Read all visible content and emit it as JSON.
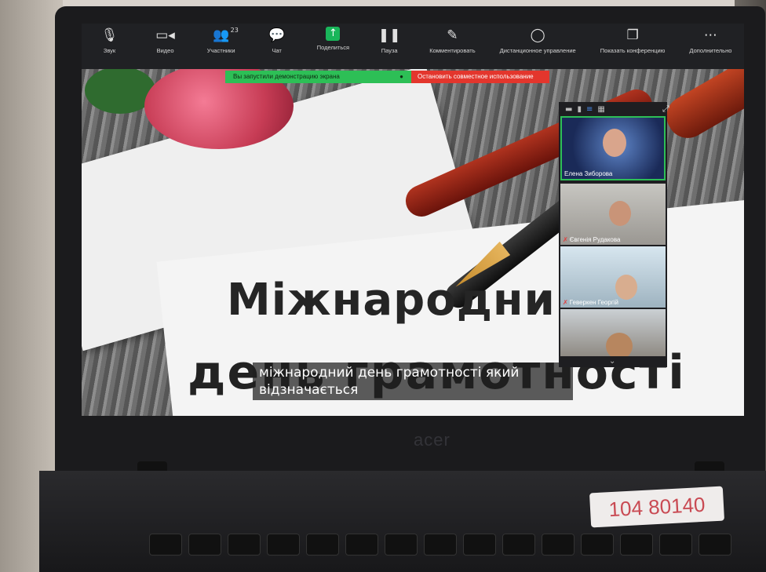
{
  "toolbar": {
    "items": [
      {
        "label": "Звук",
        "icon": "microphone-icon"
      },
      {
        "label": "Видео",
        "icon": "video-camera-icon"
      },
      {
        "label": "Участники",
        "icon": "participants-icon",
        "count": "23"
      },
      {
        "label": "Чат",
        "icon": "chat-icon"
      },
      {
        "label": "Поделиться",
        "icon": "share-screen-icon"
      },
      {
        "label": "Пауза",
        "icon": "pause-icon"
      },
      {
        "label": "Комментировать",
        "icon": "annotate-icon"
      },
      {
        "label": "Дистанционное управление",
        "icon": "remote-control-icon"
      },
      {
        "label": "Показать конференцию",
        "icon": "show-meeting-icon"
      },
      {
        "label": "Дополнительно",
        "icon": "more-icon"
      }
    ]
  },
  "share_banner": {
    "status": "Вы запустили демонстрацию экрана",
    "stop": "Остановить совместное использование"
  },
  "slide": {
    "title_line1": "Міжнародни",
    "title_line2": "день грамотності",
    "caption_line1": "міжнародний день грамотності який",
    "caption_line2": "відзначається"
  },
  "participants": [
    {
      "name": "Елена Зиборова"
    },
    {
      "name": "Євгенія Рудакова"
    },
    {
      "name": "Геверкен Георгій"
    },
    {
      "name": ""
    }
  ],
  "laptop": {
    "brand": "acer",
    "sticker": "104 80140"
  },
  "colors": {
    "share_green": "#2dbf56",
    "stop_red": "#e3362d",
    "toolbar_bg": "#202124"
  }
}
